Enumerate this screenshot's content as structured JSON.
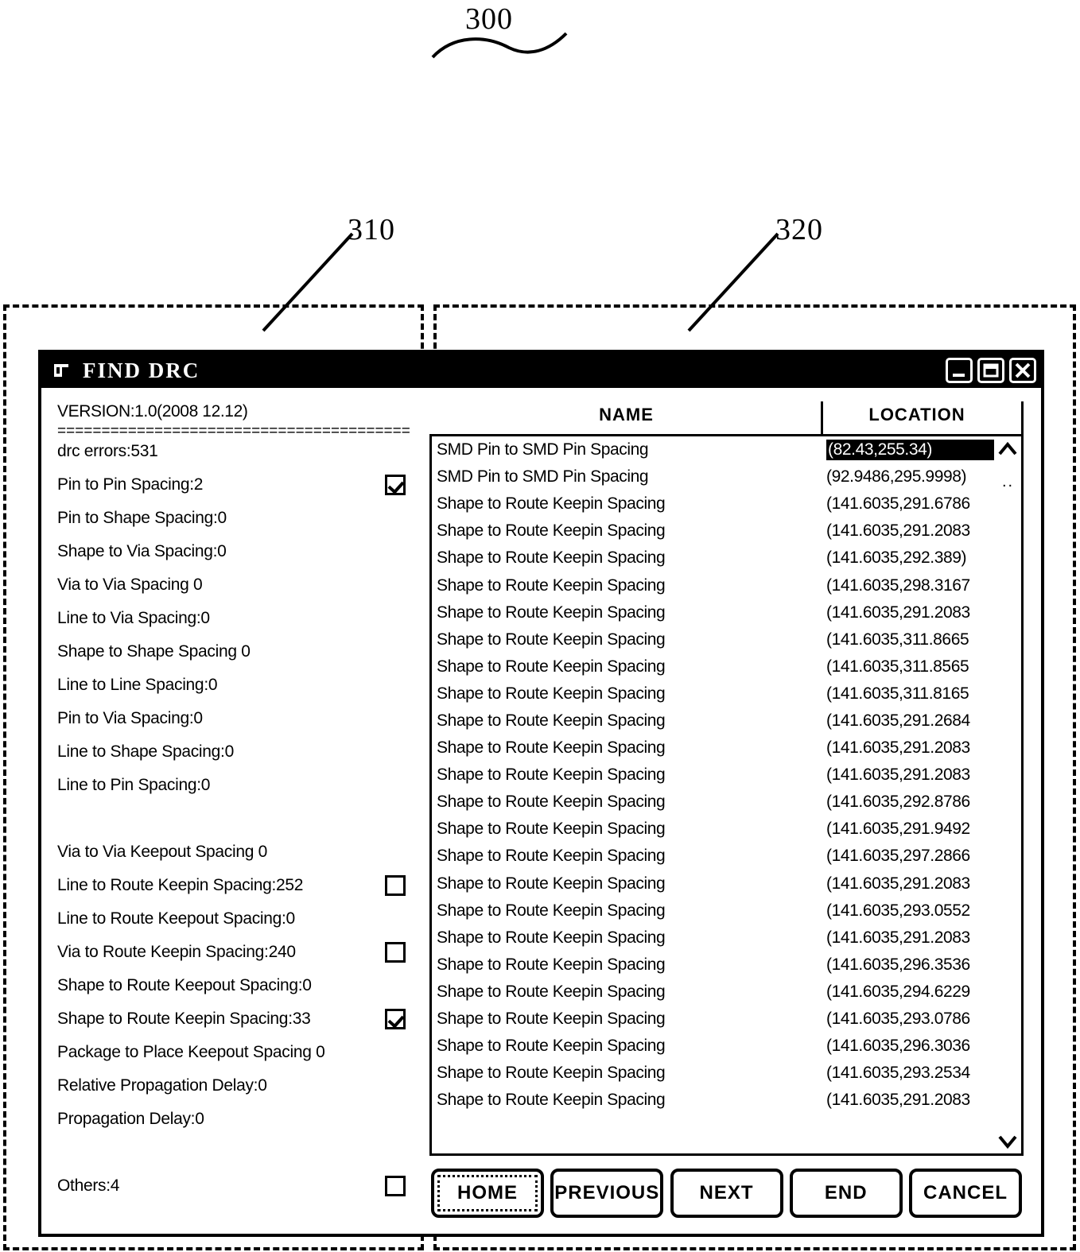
{
  "figure": {
    "ref_main": "300",
    "ref_left": "310",
    "ref_right": "320"
  },
  "window": {
    "title": "FIND DRC",
    "title_icon": "document-flag-icon",
    "controls": {
      "minimize": "minimize-icon",
      "maximize": "maximize-icon",
      "close": "close-icon"
    }
  },
  "left_panel": {
    "version": "VERSION:1.0(2008 12.12)",
    "separator": "=========================================",
    "errors": "drc errors:531",
    "rules": [
      {
        "label": "Pin to Pin Spacing:2",
        "checkbox": "checked"
      },
      {
        "label": "Pin to Shape Spacing:0",
        "checkbox": "none"
      },
      {
        "label": "Shape to Via Spacing:0",
        "checkbox": "none"
      },
      {
        "label": "Via to Via Spacing 0",
        "checkbox": "none"
      },
      {
        "label": "Line to Via Spacing:0",
        "checkbox": "none"
      },
      {
        "label": "Shape to Shape Spacing 0",
        "checkbox": "none"
      },
      {
        "label": "Line to Line Spacing:0",
        "checkbox": "none"
      },
      {
        "label": "Pin to Via Spacing:0",
        "checkbox": "none"
      },
      {
        "label": "Line to Shape Spacing:0",
        "checkbox": "none"
      },
      {
        "label": "Line to Pin Spacing:0",
        "checkbox": "none"
      },
      {
        "label": "",
        "checkbox": "none"
      },
      {
        "label": "Via to Via Keepout Spacing 0",
        "checkbox": "none"
      },
      {
        "label": "Line to Route Keepin Spacing:252",
        "checkbox": "unchecked"
      },
      {
        "label": "Line to Route Keepout Spacing:0",
        "checkbox": "none"
      },
      {
        "label": "Via to Route Keepin Spacing:240",
        "checkbox": "unchecked"
      },
      {
        "label": "Shape to Route Keepout Spacing:0",
        "checkbox": "none"
      },
      {
        "label": "Shape to Route Keepin Spacing:33",
        "checkbox": "checked"
      },
      {
        "label": "Package to Place Keepout Spacing 0",
        "checkbox": "none"
      },
      {
        "label": "Relative Propagation Delay:0",
        "checkbox": "none"
      },
      {
        "label": "Propagation Delay:0",
        "checkbox": "none"
      },
      {
        "label": "",
        "checkbox": "none"
      },
      {
        "label": "Others:4",
        "checkbox": "unchecked"
      }
    ]
  },
  "right_panel": {
    "columns": {
      "name": "NAME",
      "location": "LOCATION"
    },
    "scroll": {
      "up": "chevron-up-icon",
      "down": "chevron-down-icon",
      "dots": ".."
    },
    "rows": [
      {
        "name": "SMD Pin to SMD Pin Spacing",
        "location": "(82.43,255.34)",
        "selected": true
      },
      {
        "name": "SMD Pin to SMD Pin Spacing",
        "location": "(92.9486,295.9998)",
        "selected": false
      },
      {
        "name": "Shape to Route Keepin Spacing",
        "location": "(141.6035,291.6786",
        "selected": false
      },
      {
        "name": "Shape to Route Keepin Spacing",
        "location": "(141.6035,291.2083",
        "selected": false
      },
      {
        "name": "Shape to Route Keepin Spacing",
        "location": "(141.6035,292.389)",
        "selected": false
      },
      {
        "name": "Shape to Route Keepin Spacing",
        "location": "(141.6035,298.3167",
        "selected": false
      },
      {
        "name": "Shape to Route Keepin Spacing",
        "location": "(141.6035,291.2083",
        "selected": false
      },
      {
        "name": "Shape to Route Keepin Spacing",
        "location": "(141.6035,311.8665",
        "selected": false
      },
      {
        "name": "Shape to Route Keepin Spacing",
        "location": "(141.6035,311.8565",
        "selected": false
      },
      {
        "name": "Shape to Route Keepin Spacing",
        "location": "(141.6035,311.8165",
        "selected": false
      },
      {
        "name": "Shape to Route Keepin Spacing",
        "location": "(141.6035,291.2684",
        "selected": false
      },
      {
        "name": "Shape to Route Keepin Spacing",
        "location": "(141.6035,291.2083",
        "selected": false
      },
      {
        "name": "Shape to Route Keepin Spacing",
        "location": "(141.6035,291.2083",
        "selected": false
      },
      {
        "name": "Shape to Route Keepin Spacing",
        "location": "(141.6035,292.8786",
        "selected": false
      },
      {
        "name": "Shape to Route Keepin Spacing",
        "location": "(141.6035,291.9492",
        "selected": false
      },
      {
        "name": "Shape to Route Keepin Spacing",
        "location": "(141.6035,297.2866",
        "selected": false
      },
      {
        "name": "Shape to Route Keepin Spacing",
        "location": "(141.6035,291.2083",
        "selected": false
      },
      {
        "name": "Shape to Route Keepin Spacing",
        "location": "(141.6035,293.0552",
        "selected": false
      },
      {
        "name": "Shape to Route Keepin Spacing",
        "location": "(141.6035,291.2083",
        "selected": false
      },
      {
        "name": "Shape to Route Keepin Spacing",
        "location": "(141.6035,296.3536",
        "selected": false
      },
      {
        "name": "Shape to Route Keepin Spacing",
        "location": "(141.6035,294.6229",
        "selected": false
      },
      {
        "name": "Shape to Route Keepin Spacing",
        "location": "(141.6035,293.0786",
        "selected": false
      },
      {
        "name": "Shape to Route Keepin Spacing",
        "location": "(141.6035,296.3036",
        "selected": false
      },
      {
        "name": "Shape to Route Keepin Spacing",
        "location": "(141.6035,293.2534",
        "selected": false
      },
      {
        "name": "Shape to Route Keepin Spacing",
        "location": "(141.6035,291.2083",
        "selected": false
      }
    ]
  },
  "buttons": [
    {
      "label": "HOME",
      "focused": true
    },
    {
      "label": "PREVIOUS",
      "focused": false
    },
    {
      "label": "NEXT",
      "focused": false
    },
    {
      "label": "END",
      "focused": false
    },
    {
      "label": "CANCEL",
      "focused": false
    }
  ]
}
